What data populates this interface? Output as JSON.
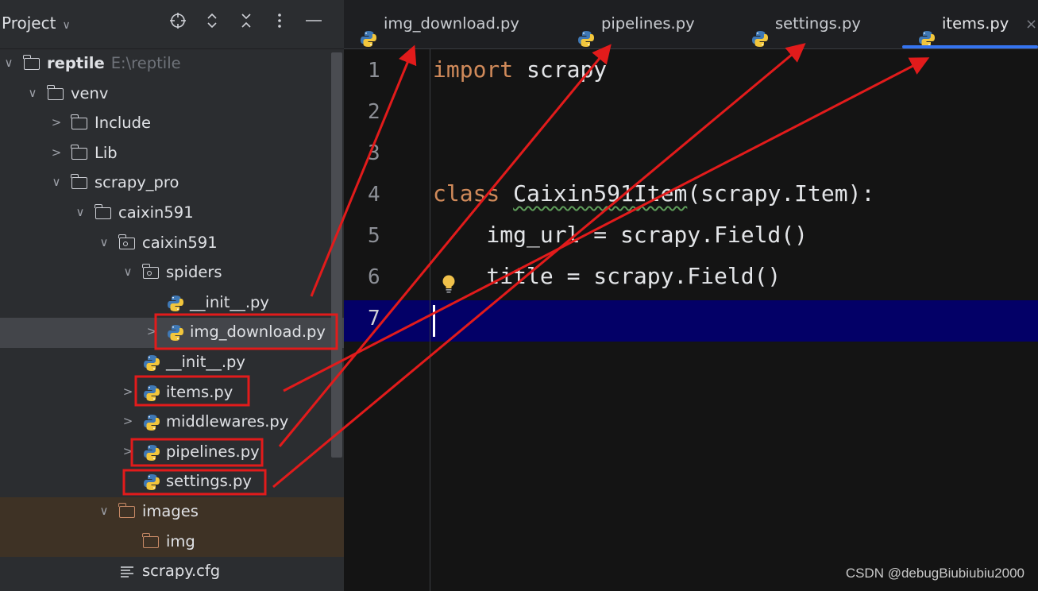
{
  "project_panel": {
    "title": "Project",
    "toolbar": [
      {
        "name": "locate-icon",
        "glyph": "⊕"
      },
      {
        "name": "expand-all-icon",
        "glyph": "⌃"
      },
      {
        "name": "collapse-all-icon",
        "glyph": "✕"
      },
      {
        "name": "more-options-icon",
        "glyph": "⋮"
      },
      {
        "name": "hide-panel-icon",
        "glyph": "—"
      }
    ],
    "tree": [
      {
        "label": "reptile",
        "hint": "E:\\reptile",
        "depth": 0,
        "expanded": true,
        "icon": "folder",
        "bold": true
      },
      {
        "label": "venv",
        "depth": 1,
        "expanded": true,
        "icon": "folder"
      },
      {
        "label": "Include",
        "depth": 2,
        "expanded": false,
        "icon": "folder"
      },
      {
        "label": "Lib",
        "depth": 2,
        "expanded": false,
        "icon": "folder"
      },
      {
        "label": "scrapy_pro",
        "depth": 2,
        "expanded": true,
        "icon": "folder"
      },
      {
        "label": "caixin591",
        "depth": 3,
        "expanded": true,
        "icon": "folder"
      },
      {
        "label": "caixin591",
        "depth": 4,
        "expanded": true,
        "icon": "package"
      },
      {
        "label": "spiders",
        "depth": 5,
        "expanded": true,
        "icon": "package"
      },
      {
        "label": "__init__.py",
        "depth": 6,
        "icon": "python"
      },
      {
        "label": "img_download.py",
        "depth": 6,
        "expanded": false,
        "icon": "python",
        "selected": true,
        "highlighted": true
      },
      {
        "label": "__init__.py",
        "depth": 5,
        "icon": "python"
      },
      {
        "label": "items.py",
        "depth": 5,
        "expanded": false,
        "icon": "python",
        "highlighted": true
      },
      {
        "label": "middlewares.py",
        "depth": 5,
        "expanded": false,
        "icon": "python"
      },
      {
        "label": "pipelines.py",
        "depth": 5,
        "expanded": false,
        "icon": "python",
        "highlighted": true
      },
      {
        "label": "settings.py",
        "depth": 5,
        "icon": "python",
        "highlighted": true
      },
      {
        "label": "images",
        "depth": 4,
        "expanded": true,
        "icon": "folder-excluded",
        "excluded": true
      },
      {
        "label": "img",
        "depth": 5,
        "icon": "folder-excluded",
        "excluded": true
      },
      {
        "label": "scrapy.cfg",
        "depth": 4,
        "icon": "config"
      }
    ]
  },
  "editor": {
    "tabs": [
      {
        "label": "img_download.py",
        "active": false
      },
      {
        "label": "pipelines.py",
        "active": false
      },
      {
        "label": "settings.py",
        "active": false
      },
      {
        "label": "items.py",
        "active": true,
        "closable": true
      }
    ],
    "close_glyph": "×",
    "lines": [
      {
        "n": "1",
        "kw": "import",
        "rest": " scrapy"
      },
      {
        "n": "2",
        "kw": "",
        "rest": ""
      },
      {
        "n": "3",
        "kw": "",
        "rest": ""
      },
      {
        "n": "4",
        "kw": "class",
        "name": "Caixin591Item",
        "rest": "(scrapy.Item):"
      },
      {
        "n": "5",
        "kw": "",
        "rest": "    img_url = scrapy.Field()"
      },
      {
        "n": "6",
        "kw": "",
        "rest": "    title = scrapy.Field()"
      },
      {
        "n": "7",
        "kw": "",
        "rest": ""
      }
    ],
    "current_line": 7
  },
  "annotation": {
    "color": "#e21b1b",
    "arrows": [
      {
        "from": "img_download.py (tree)",
        "to": "img_download.py (tab)"
      },
      {
        "from": "pipelines.py (tree)",
        "to": "pipelines.py (tab)"
      },
      {
        "from": "settings.py (tree)",
        "to": "settings.py (tab)"
      },
      {
        "from": "items.py (tree)",
        "to": "items.py (tab)"
      }
    ]
  },
  "watermark": "CSDN @debugBiubiubiu2000"
}
